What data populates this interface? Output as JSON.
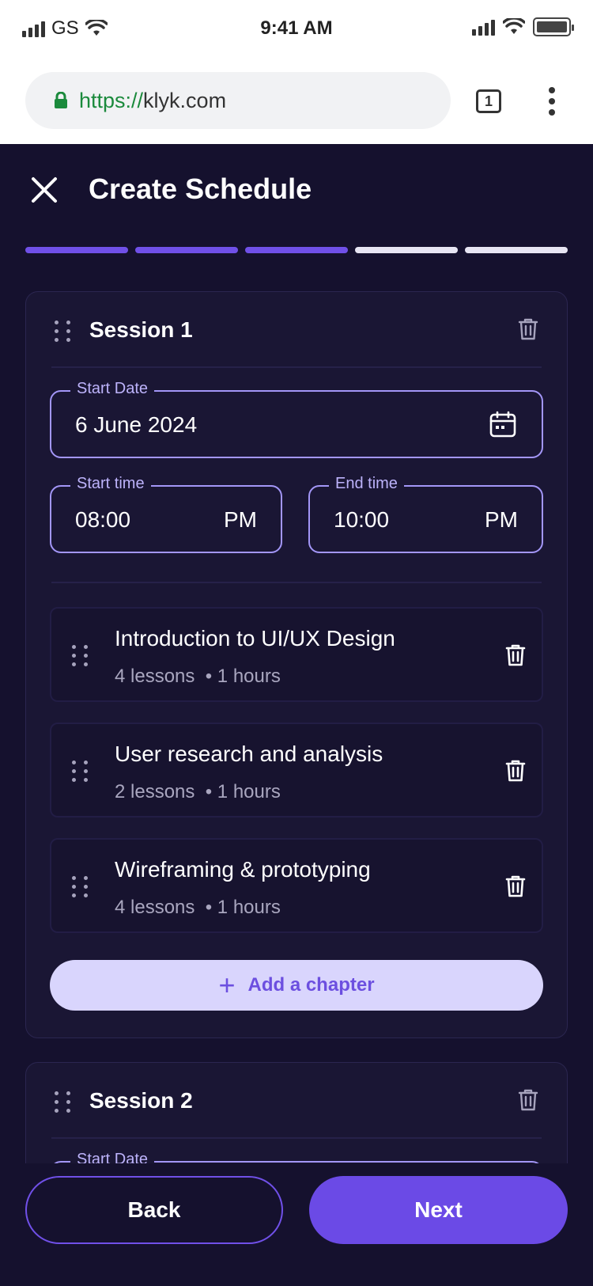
{
  "status_bar": {
    "carrier": "GS",
    "time": "9:41 AM"
  },
  "browser": {
    "url_scheme": "https://",
    "url_host": "klyk.com",
    "tab_count": "1"
  },
  "header": {
    "title": "Create Schedule"
  },
  "progress": {
    "total_steps": 5,
    "completed_steps": 3
  },
  "sessions": [
    {
      "title": "Session 1",
      "start_date_label": "Start Date",
      "start_date": "6 June 2024",
      "start_time_label": "Start time",
      "start_time": "08:00",
      "start_period": "PM",
      "end_time_label": "End time",
      "end_time": "10:00",
      "end_period": "PM",
      "chapters": [
        {
          "title": "Introduction to UI/UX Design",
          "lessons": "4 lessons",
          "duration": "• 1 hours"
        },
        {
          "title": "User research and analysis",
          "lessons": "2 lessons",
          "duration": "• 1 hours"
        },
        {
          "title": "Wireframing & prototyping",
          "lessons": "4 lessons",
          "duration": "• 1 hours"
        }
      ],
      "add_chapter_label": "Add a chapter"
    },
    {
      "title": "Session 2",
      "start_date_label": "Start Date"
    }
  ],
  "actions": {
    "back_label": "Back",
    "next_label": "Next"
  },
  "colors": {
    "background": "#15112e",
    "accent": "#6b4ae6",
    "field_border": "#a396f7",
    "add_button": "#d9d5fd"
  }
}
